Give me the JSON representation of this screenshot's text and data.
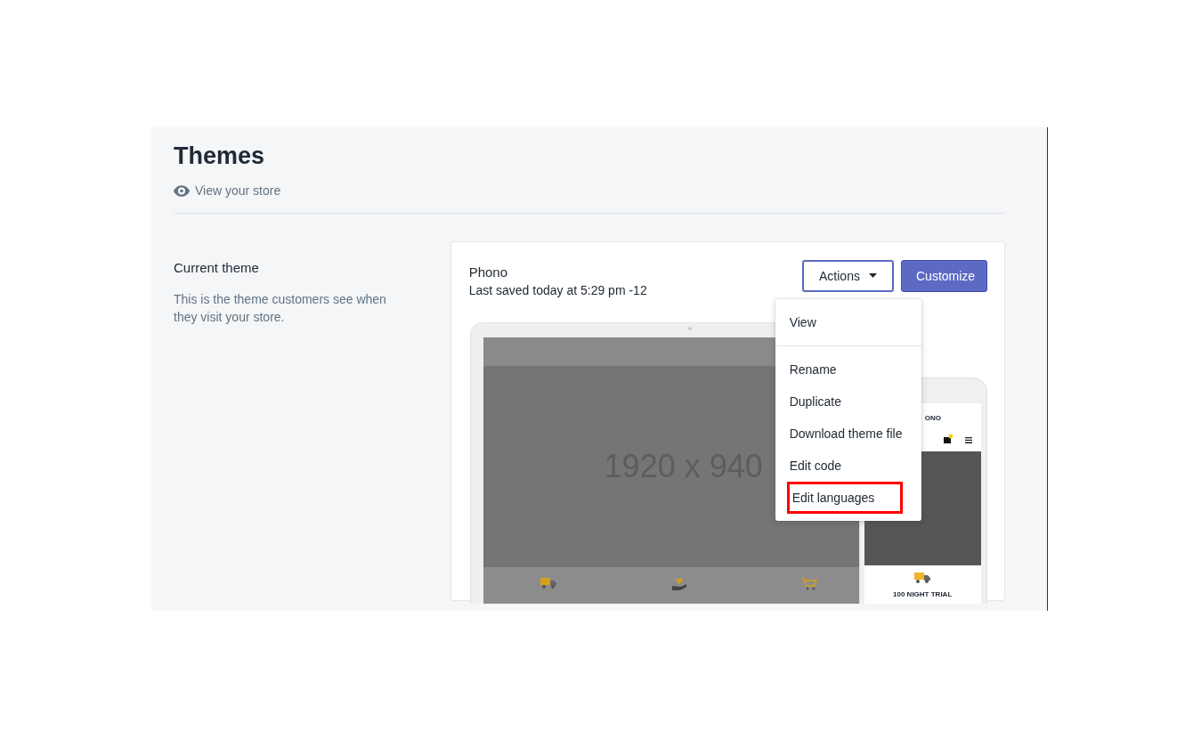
{
  "page": {
    "title": "Themes",
    "view_store_link": "View your store"
  },
  "section": {
    "heading": "Current theme",
    "description": "This is the theme customers see when they visit your store."
  },
  "theme": {
    "name": "Phono",
    "last_saved": "Last saved today at 5:29 pm -12",
    "preview": {
      "desktop_label": "1920 x 940",
      "mobile_logo": "ONO",
      "mobile_feature": "100 NIGHT TRIAL"
    }
  },
  "buttons": [
    {
      "label": "Actions",
      "kind": "dropdown",
      "expanded": true
    },
    {
      "label": "Customize",
      "kind": "primary"
    }
  ],
  "menu": {
    "groups": [
      [
        {
          "label": "View",
          "highlighted": false
        }
      ],
      [
        {
          "label": "Rename",
          "highlighted": false
        },
        {
          "label": "Duplicate",
          "highlighted": false
        },
        {
          "label": "Download theme file",
          "highlighted": false
        },
        {
          "label": "Edit code",
          "highlighted": false
        },
        {
          "label": "Edit languages",
          "highlighted": true
        }
      ]
    ]
  }
}
